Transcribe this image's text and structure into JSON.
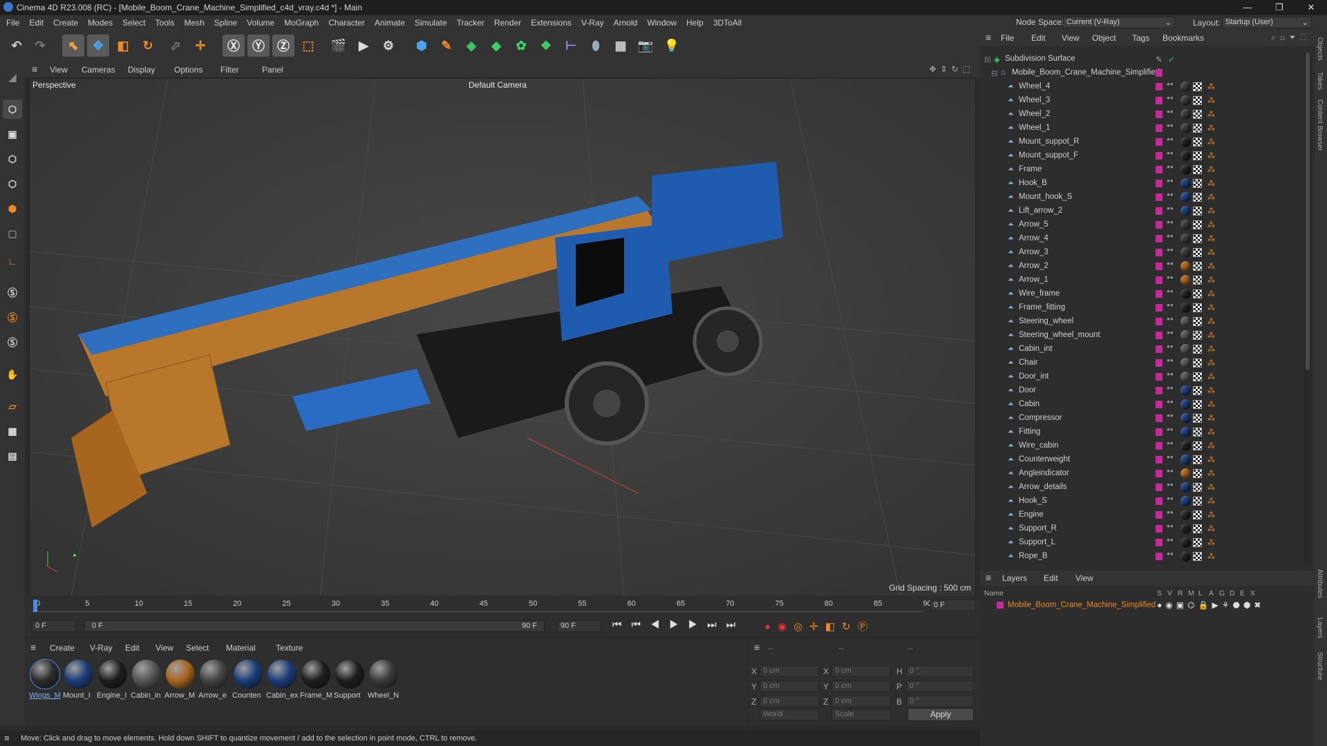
{
  "window": {
    "title": "Cinema 4D R23.008 (RC) - [Mobile_Boom_Crane_Machine_Simplified_c4d_vray.c4d *] - Main",
    "minimize": "—",
    "restore": "❐",
    "close": "✕"
  },
  "menu": [
    "File",
    "Edit",
    "Create",
    "Modes",
    "Select",
    "Tools",
    "Mesh",
    "Spline",
    "Volume",
    "MoGraph",
    "Character",
    "Animate",
    "Simulate",
    "Tracker",
    "Render",
    "Extensions",
    "V-Ray",
    "Arnold",
    "Window",
    "Help",
    "3DToAll"
  ],
  "nodespace": {
    "label": "Node Space:",
    "value": "Current (V-Ray)",
    "layout_label": "Layout:",
    "layout_value": "Startup (User)"
  },
  "viewport_menu": [
    "View",
    "Cameras",
    "Display",
    "Options",
    "Filter",
    "Panel"
  ],
  "viewport": {
    "name": "Perspective",
    "camera": "Default Camera",
    "grid_spacing": "Grid Spacing : 500 cm"
  },
  "objects_menu": [
    "File",
    "Edit",
    "View",
    "Object",
    "Tags",
    "Bookmarks"
  ],
  "objects": {
    "root": "Subdivision Surface",
    "group": "Mobile_Boom_Crane_Machine_Simplified",
    "items": [
      {
        "name": "Wheel_4",
        "mat": "#3a3a3a"
      },
      {
        "name": "Wheel_3",
        "mat": "#3a3a3a"
      },
      {
        "name": "Wheel_2",
        "mat": "#3a3a3a"
      },
      {
        "name": "Wheel_1",
        "mat": "#3a3a3a"
      },
      {
        "name": "Mount_suppot_R",
        "mat": "#222"
      },
      {
        "name": "Mount_suppot_F",
        "mat": "#222"
      },
      {
        "name": "Frame",
        "mat": "#222"
      },
      {
        "name": "Hook_B",
        "mat": "#1c3d7a"
      },
      {
        "name": "Mount_hook_S",
        "mat": "#1c3d7a"
      },
      {
        "name": "Lift_arrow_2",
        "mat": "#1c3d7a"
      },
      {
        "name": "Arrow_5",
        "mat": "#3a3a3a"
      },
      {
        "name": "Arrow_4",
        "mat": "#3a3a3a"
      },
      {
        "name": "Arrow_3",
        "mat": "#3a3a3a"
      },
      {
        "name": "Arrow_2",
        "mat": "#a8651e"
      },
      {
        "name": "Arrow_1",
        "mat": "#a8651e"
      },
      {
        "name": "Wire_frame",
        "mat": "#222"
      },
      {
        "name": "Frame_fitting",
        "mat": "#222"
      },
      {
        "name": "Steering_wheel",
        "mat": "#555"
      },
      {
        "name": "Steering_wheel_mount",
        "mat": "#555"
      },
      {
        "name": "Cabin_int",
        "mat": "#555"
      },
      {
        "name": "Chair",
        "mat": "#555"
      },
      {
        "name": "Door_int",
        "mat": "#555"
      },
      {
        "name": "Door",
        "mat": "#1c3d7a"
      },
      {
        "name": "Cabin",
        "mat": "#1c3d7a"
      },
      {
        "name": "Compressor",
        "mat": "#1c3d7a"
      },
      {
        "name": "Fitting",
        "mat": "#1c3d7a"
      },
      {
        "name": "Wire_cabin",
        "mat": "#222"
      },
      {
        "name": "Counterweight",
        "mat": "#1c3d7a"
      },
      {
        "name": "Angleindicator",
        "mat": "#a8651e"
      },
      {
        "name": "Arrow_details",
        "mat": "#1c3d7a"
      },
      {
        "name": "Hook_S",
        "mat": "#1c3d7a"
      },
      {
        "name": "Engine",
        "mat": "#222"
      },
      {
        "name": "Support_R",
        "mat": "#222"
      },
      {
        "name": "Support_L",
        "mat": "#222"
      },
      {
        "name": "Rope_B",
        "mat": "#222"
      }
    ]
  },
  "layers": {
    "menu": [
      "Layers",
      "Edit",
      "View"
    ],
    "columns": [
      "Name",
      "S",
      "V",
      "R",
      "M",
      "L",
      "A",
      "G",
      "D",
      "E",
      "X"
    ],
    "row": "Mobile_Boom_Crane_Machine_Simplified"
  },
  "timeline": {
    "ticks": [
      "0",
      "5",
      "10",
      "15",
      "20",
      "25",
      "30",
      "35",
      "40",
      "45",
      "50",
      "55",
      "60",
      "65",
      "70",
      "75",
      "80",
      "85",
      "90"
    ],
    "end_field": "0 F",
    "start": "0 F",
    "range_start": "0 F",
    "range_end": "90 F",
    "max": "90 F"
  },
  "material_menu": [
    "Create",
    "V-Ray",
    "Edit",
    "View",
    "Select",
    "Material",
    "Texture"
  ],
  "materials": [
    {
      "label": "Wings_M",
      "color": "#2c2c2c"
    },
    {
      "label": "Mount_I",
      "color": "#1c3d7a"
    },
    {
      "label": "Engine_I",
      "color": "#1e1e1e"
    },
    {
      "label": "Cabin_in",
      "color": "#555"
    },
    {
      "label": "Arrow_M",
      "color": "#a8651e"
    },
    {
      "label": "Arrow_e",
      "color": "#444"
    },
    {
      "label": "Counten",
      "color": "#1c3d7a"
    },
    {
      "label": "Cabin_ex",
      "color": "#1c3d7a"
    },
    {
      "label": "Frame_M",
      "color": "#1e1e1e"
    },
    {
      "label": "Support",
      "color": "#1e1e1e"
    },
    {
      "label": "Wheel_N",
      "color": "#3a3a3a"
    }
  ],
  "coords": {
    "header": [
      "--",
      "--",
      "--"
    ],
    "rows": [
      {
        "a": "X",
        "av": "0 cm",
        "b": "X",
        "bv": "0 cm",
        "c": "H",
        "cv": "0 °"
      },
      {
        "a": "Y",
        "av": "0 cm",
        "b": "Y",
        "bv": "0 cm",
        "c": "P",
        "cv": "0 °"
      },
      {
        "a": "Z",
        "av": "0 cm",
        "b": "Z",
        "bv": "0 cm",
        "c": "B",
        "cv": "0 °"
      }
    ],
    "space": "World",
    "mode": "Scale",
    "apply": "Apply"
  },
  "status": "Move: Click and drag to move elements. Hold down SHIFT to quantize movement / add to the selection in point mode, CTRL to remove.",
  "side_tabs": [
    "Objects",
    "Takes",
    "Content Browser",
    "Attributes",
    "Layers",
    "Structure"
  ]
}
